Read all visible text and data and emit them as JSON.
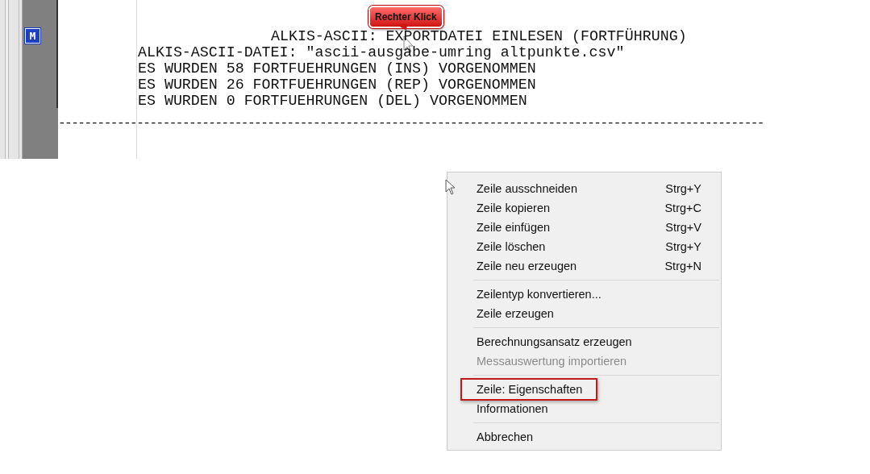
{
  "editor": {
    "marker": "M",
    "heading": "ALKIS-ASCII: EXPORTDATEI EINLESEN (FORTFÜHRUNG)",
    "lines": [
      "ALKIS-ASCII-DATEI: \"ascii-ausgabe-umring altpunkte.csv\"",
      "ES WURDEN 58 FORTFUEHRUNGEN (INS) VORGENOMMEN",
      "ES WURDEN 26 FORTFUEHRUNGEN (REP) VORGENOMMEN",
      "ES WURDEN 0 FORTFUEHRUNGEN (DEL) VORGENOMMEN"
    ],
    "separator": "------------------------------------------------------------------------------------------------------------"
  },
  "callout": {
    "label": "Rechter Klick"
  },
  "context_menu": {
    "groups": [
      [
        {
          "label": "Zeile ausschneiden",
          "shortcut": "Strg+Y",
          "disabled": false,
          "highlighted": false
        },
        {
          "label": "Zeile kopieren",
          "shortcut": "Strg+C",
          "disabled": false,
          "highlighted": false
        },
        {
          "label": "Zeile einfügen",
          "shortcut": "Strg+V",
          "disabled": false,
          "highlighted": false
        },
        {
          "label": "Zeile löschen",
          "shortcut": "Strg+Y",
          "disabled": false,
          "highlighted": false
        },
        {
          "label": "Zeile neu erzeugen",
          "shortcut": "Strg+N",
          "disabled": false,
          "highlighted": false
        }
      ],
      [
        {
          "label": "Zeilentyp konvertieren...",
          "disabled": false,
          "highlighted": false
        },
        {
          "label": "Zeile erzeugen",
          "disabled": false,
          "highlighted": false
        }
      ],
      [
        {
          "label": "Berechnungsansatz erzeugen",
          "disabled": false,
          "highlighted": false
        },
        {
          "label": "Messauswertung importieren",
          "disabled": true,
          "highlighted": false
        }
      ],
      [
        {
          "label": "Zeile: Eigenschaften",
          "disabled": false,
          "highlighted": true
        },
        {
          "label": "Informationen",
          "disabled": false,
          "highlighted": false
        }
      ],
      [
        {
          "label": "Abbrechen",
          "disabled": false,
          "highlighted": false
        }
      ]
    ]
  }
}
